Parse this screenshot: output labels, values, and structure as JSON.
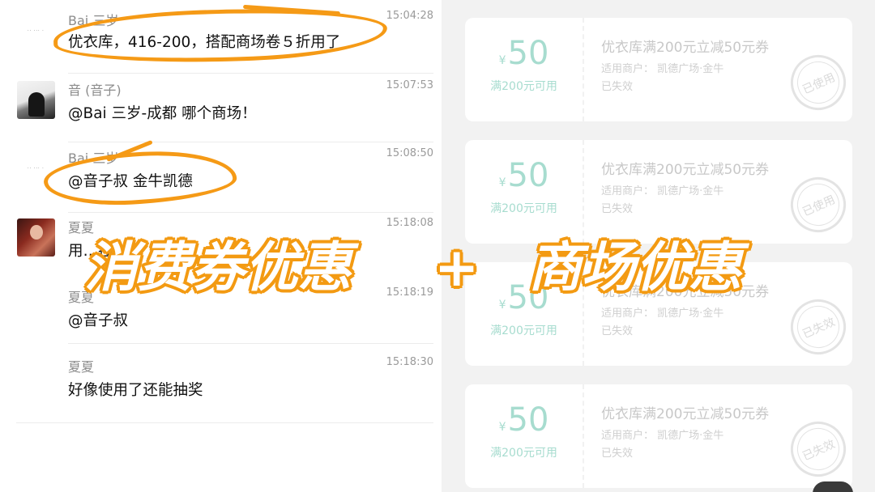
{
  "chat": {
    "messages": [
      {
        "name": "Bai 三岁",
        "time": "15:04:28",
        "text": "优衣库，416-200，搭配商场卷５折用了",
        "avatar": "blank-avatar"
      },
      {
        "name": "音 (音子)",
        "time": "15:07:53",
        "text": "@Bai 三岁-成都 哪个商场！",
        "avatar": "photo-avatar-dark"
      },
      {
        "name": "Bai 三岁",
        "time": "15:08:50",
        "text": "@音子叔 金牛凯德",
        "avatar": "blank-avatar"
      },
      {
        "name": "夏夏",
        "time": "15:18:08",
        "text": "用…挂…子",
        "avatar": "photo-avatar-red"
      },
      {
        "name": "夏夏",
        "time": "15:18:19",
        "text": "@音子叔",
        "avatar": "none"
      },
      {
        "name": "夏夏",
        "time": "15:18:30",
        "text": "好像使用了还能抽奖",
        "avatar": "none"
      }
    ]
  },
  "coupons": [
    {
      "currency": "¥",
      "amount": "50",
      "condition": "满200元可用",
      "title": "优衣库满200元立减50元券",
      "merchant": "适用商户：  凯德广场·金牛",
      "status": "已失效",
      "stamp": "已使用"
    },
    {
      "currency": "¥",
      "amount": "50",
      "condition": "满200元可用",
      "title": "优衣库满200元立减50元券",
      "merchant": "适用商户：  凯德广场·金牛",
      "status": "已失效",
      "stamp": "已使用"
    },
    {
      "currency": "¥",
      "amount": "50",
      "condition": "满200元可用",
      "title": "优衣库满200元立减50元券",
      "merchant": "适用商户：  凯德广场·金牛",
      "status": "已失效",
      "stamp": "已失效"
    },
    {
      "currency": "¥",
      "amount": "50",
      "condition": "满200元可用",
      "title": "优衣库满200元立减50元券",
      "merchant": "适用商户：  凯德广场·金牛",
      "status": "已失效",
      "stamp": "已失效"
    }
  ],
  "headline": {
    "part1": "消费券优惠",
    "plus": "+",
    "part2": "商场优惠"
  },
  "colors": {
    "accent_orange": "#f59a16",
    "coupon_teal": "#a7dccf",
    "panel_gray": "#f2f2f2"
  }
}
